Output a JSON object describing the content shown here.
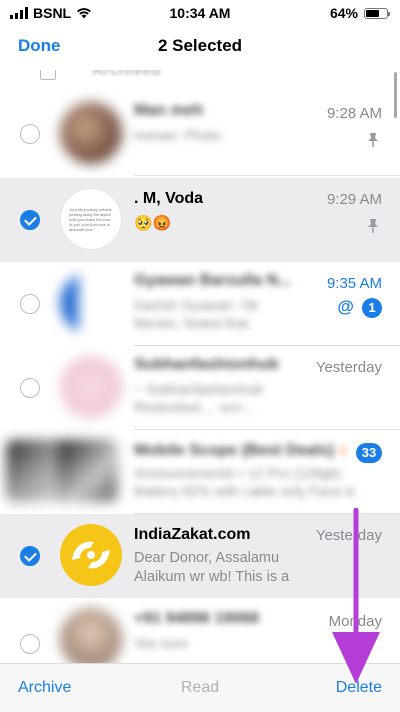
{
  "status": {
    "carrier": "BSNL",
    "time": "10:34 AM",
    "battery": "64%",
    "battery_level": 0.64
  },
  "nav": {
    "done_label": "Done",
    "title": "2 Selected"
  },
  "archived_label": "Archived",
  "chats": [
    {
      "name": "Man meh",
      "preview": "manan: Photo",
      "time": "9:28 AM",
      "selected": false,
      "blurred": true,
      "pinned": true
    },
    {
      "name": ". M, Voda",
      "preview": "🥺😡",
      "time": "9:29 AM",
      "selected": true,
      "blurred": false,
      "pinned": true,
      "avatar_text": "Your life journey unfolds pealing away the layers until you reach the core of you. And that core is absolute love."
    },
    {
      "name": "Gyawan Barzulla N...",
      "preview": "Danish Gyawan: Ok",
      "preview2": "Ma'am, Noted that.",
      "time": "9:35 AM",
      "selected": false,
      "blurred": true,
      "mention": "@",
      "badge": "1"
    },
    {
      "name": "Subhanfashionhub",
      "preview": "~ Subhanfashionhub",
      "preview2": "Restocked ... scri...",
      "time": "Yesterday",
      "selected": false,
      "blurred": true
    },
    {
      "name": "Mobile Scope (Best Deals) 🔥",
      "preview": "Announcements • 12 Pro (128gb)",
      "preview2": "Battery 82% with cable only Face id o...",
      "time": "",
      "selected": false,
      "blurred": true,
      "badge": "33"
    },
    {
      "name": "IndiaZakat.com",
      "preview": "Dear Donor, Assalamu",
      "preview2": "Alaikum wr wb! This is a",
      "time": "Yesterday",
      "selected": true,
      "blurred": false
    },
    {
      "name": "+91 94896 19068",
      "preview": "Yes sure",
      "time": "Monday",
      "selected": false,
      "blurred": true
    }
  ],
  "toolbar": {
    "archive_label": "Archive",
    "read_label": "Read",
    "delete_label": "Delete"
  },
  "colors": {
    "accent": "#1a7ee6",
    "selected_row": "#ececee",
    "annotation_arrow": "#b63ed8",
    "zakat_yellow": "#f5c518"
  }
}
